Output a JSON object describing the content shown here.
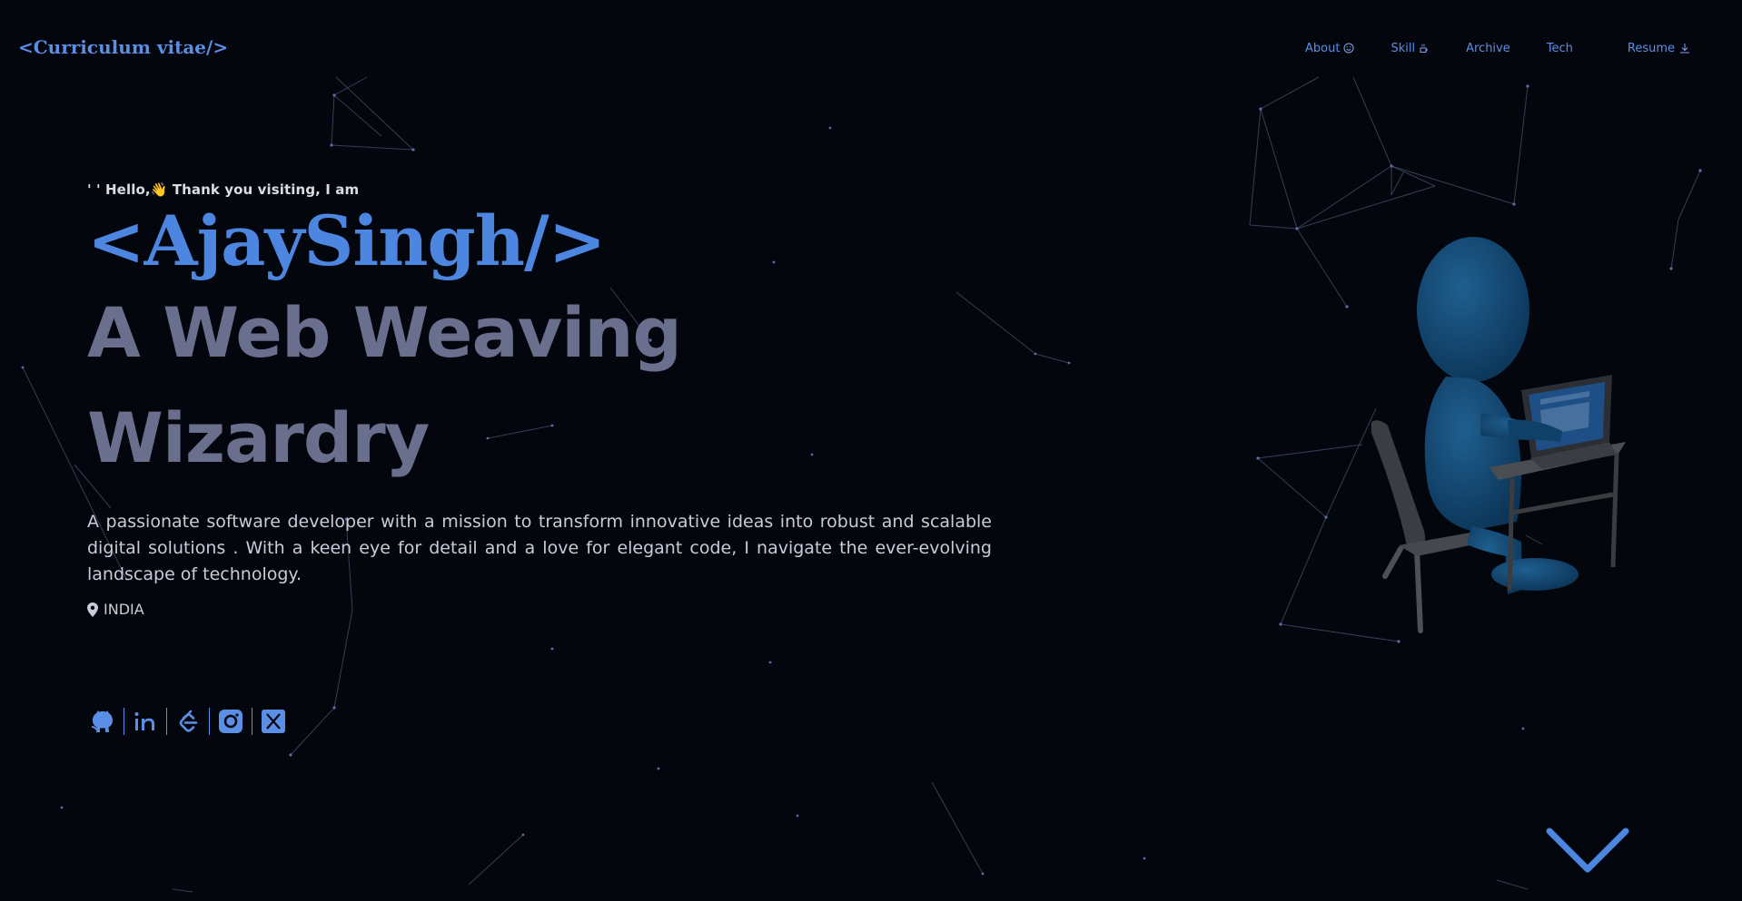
{
  "header": {
    "logo": "<Curriculum vitae/>",
    "nav": [
      {
        "label": "About",
        "icon": "smile-icon"
      },
      {
        "label": "Skill",
        "icon": "coffee-icon"
      },
      {
        "label": "Archive",
        "icon": ""
      },
      {
        "label": "Tech",
        "icon": ""
      },
      {
        "label": "Resume",
        "icon": "download-icon"
      }
    ]
  },
  "hero": {
    "greeting": "' ' Hello,👋 Thank you visiting, I am",
    "name": "<AjaySingh/>",
    "tagline_line1": "A Web Weaving",
    "tagline_line2": "Wizardry",
    "description": "A passionate software developer with a mission to transform innovative ideas into robust and scalable digital solutions . With a keen eye for detail and a love for elegant code, I navigate the ever-evolving landscape of technology.",
    "location": "INDIA",
    "socials": [
      "github-icon",
      "linkedin-icon",
      "leetcode-icon",
      "instagram-icon",
      "x-twitter-icon"
    ]
  },
  "colors": {
    "background": "#04060d",
    "accent": "#4d86e0",
    "tagline": "#6b6f8e",
    "text": "#c8ccd8"
  }
}
